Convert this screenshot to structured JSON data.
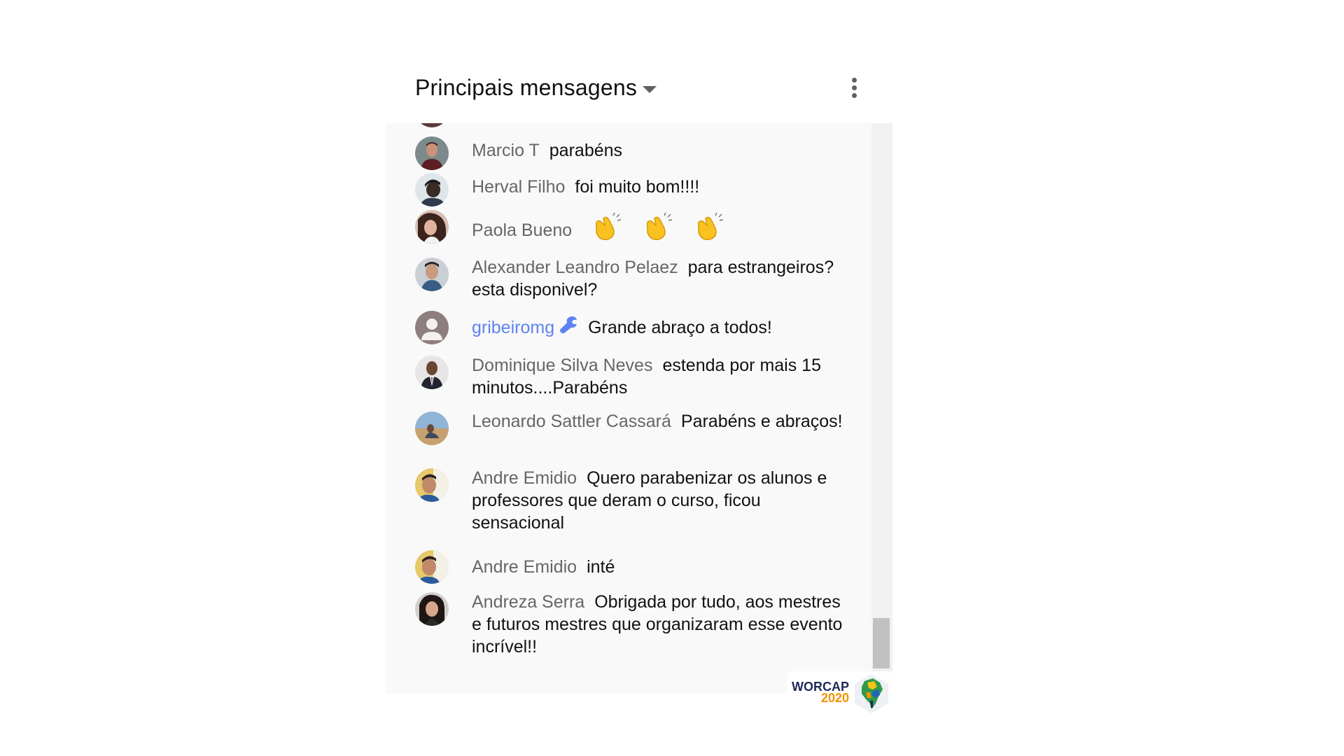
{
  "header": {
    "title": "Principais mensagens"
  },
  "colors": {
    "author": "#666666",
    "owner_author": "#5e84f1",
    "message_text": "#111111",
    "chat_background": "#f9f9f9",
    "brand_blue": "#1e2a5a",
    "brand_orange": "#f39200"
  },
  "messages": [
    {
      "author": "Marcio T",
      "text": "parabéns",
      "avatar": "photo"
    },
    {
      "author": "Herval Filho",
      "text": "foi muito bom!!!!",
      "avatar": "photo"
    },
    {
      "author": "Paola Bueno",
      "text": "",
      "emoji": "clapping-hands-icon",
      "emoji_count": 3,
      "avatar": "photo"
    },
    {
      "author": "Alexander Leandro Pelaez",
      "text": "para estrangeiros? esta disponivel?",
      "avatar": "photo"
    },
    {
      "author": "gribeiromg",
      "text": "Grande abraço a todos!",
      "badge": "wrench-icon",
      "avatar": "default-person"
    },
    {
      "author": "Dominique Silva Neves",
      "text": "estenda por mais 15 minutos....Parabéns",
      "avatar": "photo"
    },
    {
      "author": "Leonardo Sattler Cassará",
      "text": "Parabéns e abraços!",
      "avatar": "photo"
    },
    {
      "author": "Andre Emidio",
      "text": "Quero parabenizar os alunos e professores que deram o curso, ficou sensacional",
      "avatar": "photo"
    },
    {
      "author": "Andre Emidio",
      "text": "inté",
      "avatar": "photo"
    },
    {
      "author": "Andreza Serra",
      "text": "Obrigada por tudo, aos mestres e futuros mestres que organizaram esse evento incrível!!",
      "avatar": "photo"
    }
  ],
  "watermark": {
    "line1": "WORCAP",
    "line2": "2020"
  }
}
